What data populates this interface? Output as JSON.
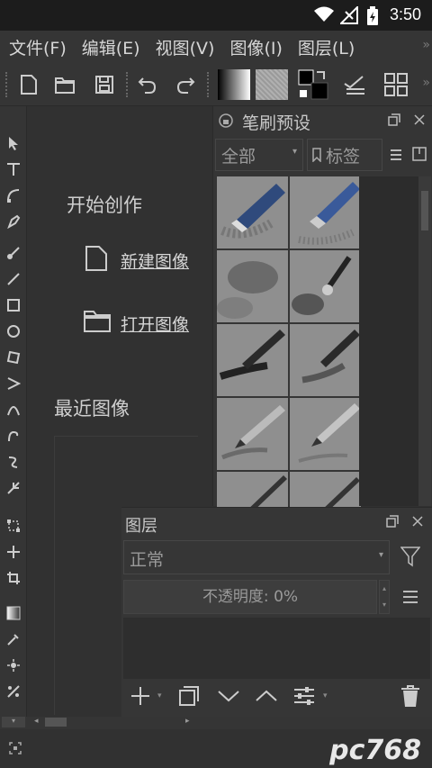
{
  "status_bar": {
    "time": "3:50"
  },
  "menu": {
    "items": [
      "文件(F)",
      "编辑(E)",
      "视图(V)",
      "图像(I)",
      "图层(L)"
    ],
    "more": "»"
  },
  "toolbar": {
    "icons": [
      "new-document-icon",
      "open-folder-icon",
      "save-icon",
      "undo-icon",
      "redo-icon",
      "gradient-icon",
      "pattern-icon",
      "color-swap-icon",
      "layer-options-icon",
      "workspace-grid-icon"
    ]
  },
  "welcome": {
    "heading": "开始创作",
    "new_image": "新建图像",
    "open_image": "打开图像",
    "recent": "最近图像"
  },
  "brush_presets": {
    "title": "笔刷预设",
    "filter": "全部",
    "tag": "标签"
  },
  "layers": {
    "title": "图层",
    "blend_mode": "正常",
    "opacity": "不透明度:  0%"
  },
  "watermark": "pc768"
}
